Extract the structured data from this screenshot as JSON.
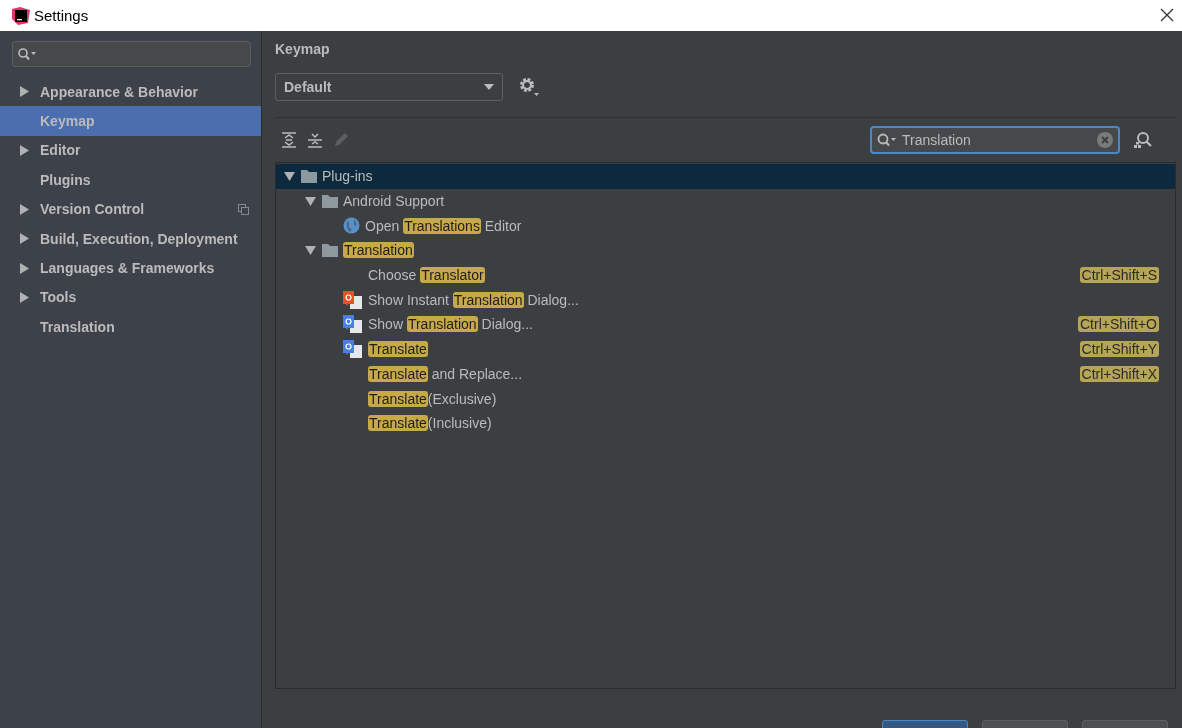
{
  "window": {
    "title": "Settings"
  },
  "sidebar": {
    "items": [
      {
        "label": "Appearance & Behavior",
        "expandable": true,
        "selected": false,
        "project_icon": false
      },
      {
        "label": "Keymap",
        "expandable": false,
        "selected": true,
        "project_icon": false
      },
      {
        "label": "Editor",
        "expandable": true,
        "selected": false,
        "project_icon": false
      },
      {
        "label": "Plugins",
        "expandable": false,
        "selected": false,
        "project_icon": false
      },
      {
        "label": "Version Control",
        "expandable": true,
        "selected": false,
        "project_icon": true
      },
      {
        "label": "Build, Execution, Deployment",
        "expandable": true,
        "selected": false,
        "project_icon": false
      },
      {
        "label": "Languages & Frameworks",
        "expandable": true,
        "selected": false,
        "project_icon": false
      },
      {
        "label": "Tools",
        "expandable": true,
        "selected": false,
        "project_icon": false
      },
      {
        "label": "Translation",
        "expandable": false,
        "selected": false,
        "project_icon": false
      }
    ]
  },
  "page": {
    "title": "Keymap",
    "keymap_dropdown": {
      "value": "Default"
    },
    "filter": {
      "value": "Translation"
    }
  },
  "tree": [
    {
      "kind": "folder",
      "expanded": true,
      "selected": true,
      "parts": [
        {
          "text": "Plug-ins",
          "match": false
        }
      ],
      "children": [
        {
          "kind": "folder",
          "expanded": true,
          "selected": false,
          "parts": [
            {
              "text": "Android Support",
              "match": false
            }
          ],
          "children": [
            {
              "kind": "globe",
              "selected": false,
              "parts": [
                {
                  "text": "Open ",
                  "match": false
                },
                {
                  "text": "Translations",
                  "match": true
                },
                {
                  "text": " Editor",
                  "match": false
                }
              ]
            }
          ]
        },
        {
          "kind": "folder",
          "expanded": true,
          "selected": false,
          "parts": [
            {
              "text": "Translation",
              "match": true
            }
          ],
          "children": [
            {
              "kind": "plain",
              "selected": false,
              "parts": [
                {
                  "text": "Choose ",
                  "match": false
                },
                {
                  "text": "Translator",
                  "match": true
                }
              ],
              "shortcut": "Ctrl+Shift+S"
            },
            {
              "kind": "instant",
              "selected": false,
              "parts": [
                {
                  "text": "Show Instant ",
                  "match": false
                },
                {
                  "text": "Translation",
                  "match": true
                },
                {
                  "text": " Dialog...",
                  "match": false
                }
              ]
            },
            {
              "kind": "translator",
              "selected": false,
              "parts": [
                {
                  "text": "Show ",
                  "match": false
                },
                {
                  "text": "Translation",
                  "match": true
                },
                {
                  "text": " Dialog...",
                  "match": false
                }
              ],
              "shortcut": "Ctrl+Shift+O"
            },
            {
              "kind": "translator",
              "selected": false,
              "parts": [
                {
                  "text": "Translate",
                  "match": true
                }
              ],
              "shortcut": "Ctrl+Shift+Y"
            },
            {
              "kind": "plain",
              "selected": false,
              "parts": [
                {
                  "text": "Translate",
                  "match": true
                },
                {
                  "text": " and Replace...",
                  "match": false
                }
              ],
              "shortcut": "Ctrl+Shift+X"
            },
            {
              "kind": "plain",
              "selected": false,
              "parts": [
                {
                  "text": "Translate",
                  "match": true
                },
                {
                  "text": "(Exclusive)",
                  "match": false
                }
              ]
            },
            {
              "kind": "plain",
              "selected": false,
              "parts": [
                {
                  "text": "Translate",
                  "match": true
                },
                {
                  "text": "(Inclusive)",
                  "match": false
                }
              ]
            }
          ]
        }
      ]
    }
  ]
}
